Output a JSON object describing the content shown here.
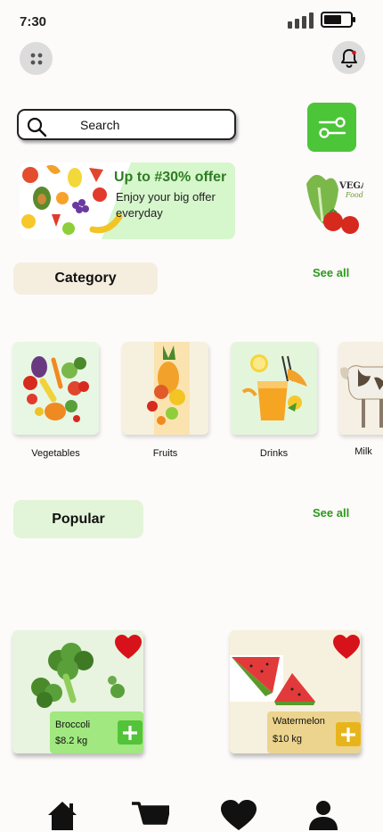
{
  "status": {
    "time": "7:30"
  },
  "search": {
    "placeholder": "Search"
  },
  "banner": {
    "title": "Up to #30% offer",
    "subtitle": "Enjoy your big offer everyday",
    "secondary_brand": "VEGAI",
    "secondary_sub": "Food"
  },
  "category": {
    "title": "Category",
    "see_all": "See all",
    "items": [
      {
        "label": "Vegetables",
        "bg": "#e8f7e4"
      },
      {
        "label": "Fruits",
        "bg": "#f6f0de"
      },
      {
        "label": "Drinks",
        "bg": "#e3f6dc"
      },
      {
        "label": "Milk",
        "bg": "#f6f0e4"
      }
    ]
  },
  "popular": {
    "title": "Popular",
    "see_all": "See all",
    "items": [
      {
        "name": "Broccoli",
        "price": "$8.2  kg",
        "card_bg": "#e8f3e0",
        "price_bg": "#a0e87f",
        "add_color": "#53c33a"
      },
      {
        "name": "Watermelon",
        "price": "$10 kg",
        "card_bg": "#f6f0de",
        "price_bg": "#ecd48e",
        "add_color": "#e7b51b"
      }
    ]
  },
  "nav": [
    "home-icon",
    "cart-icon",
    "heart-icon",
    "profile-icon"
  ],
  "colors": {
    "accent_green": "#4cc538",
    "heart_red": "#d8121a",
    "see_all": "#2a9a1b"
  }
}
